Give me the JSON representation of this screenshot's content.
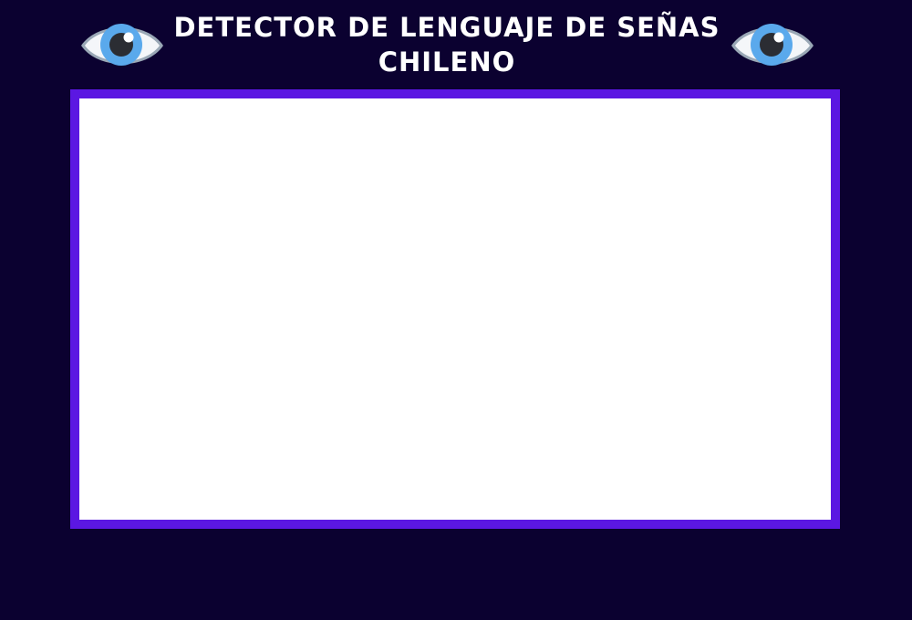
{
  "header": {
    "title": "DETECTOR DE LENGUAJE DE SEÑAS CHILENO",
    "left_icon": "eye-icon",
    "right_icon": "eye-icon"
  },
  "video": {
    "frame_color": "#5b17e2",
    "content_color": "#ffffff"
  },
  "theme": {
    "background": "#0b0130",
    "title_color": "#ffffff",
    "eye_iris": "#5aa9ec",
    "eye_pupil": "#2b2d33",
    "eye_outline": "#9aa8b6"
  }
}
